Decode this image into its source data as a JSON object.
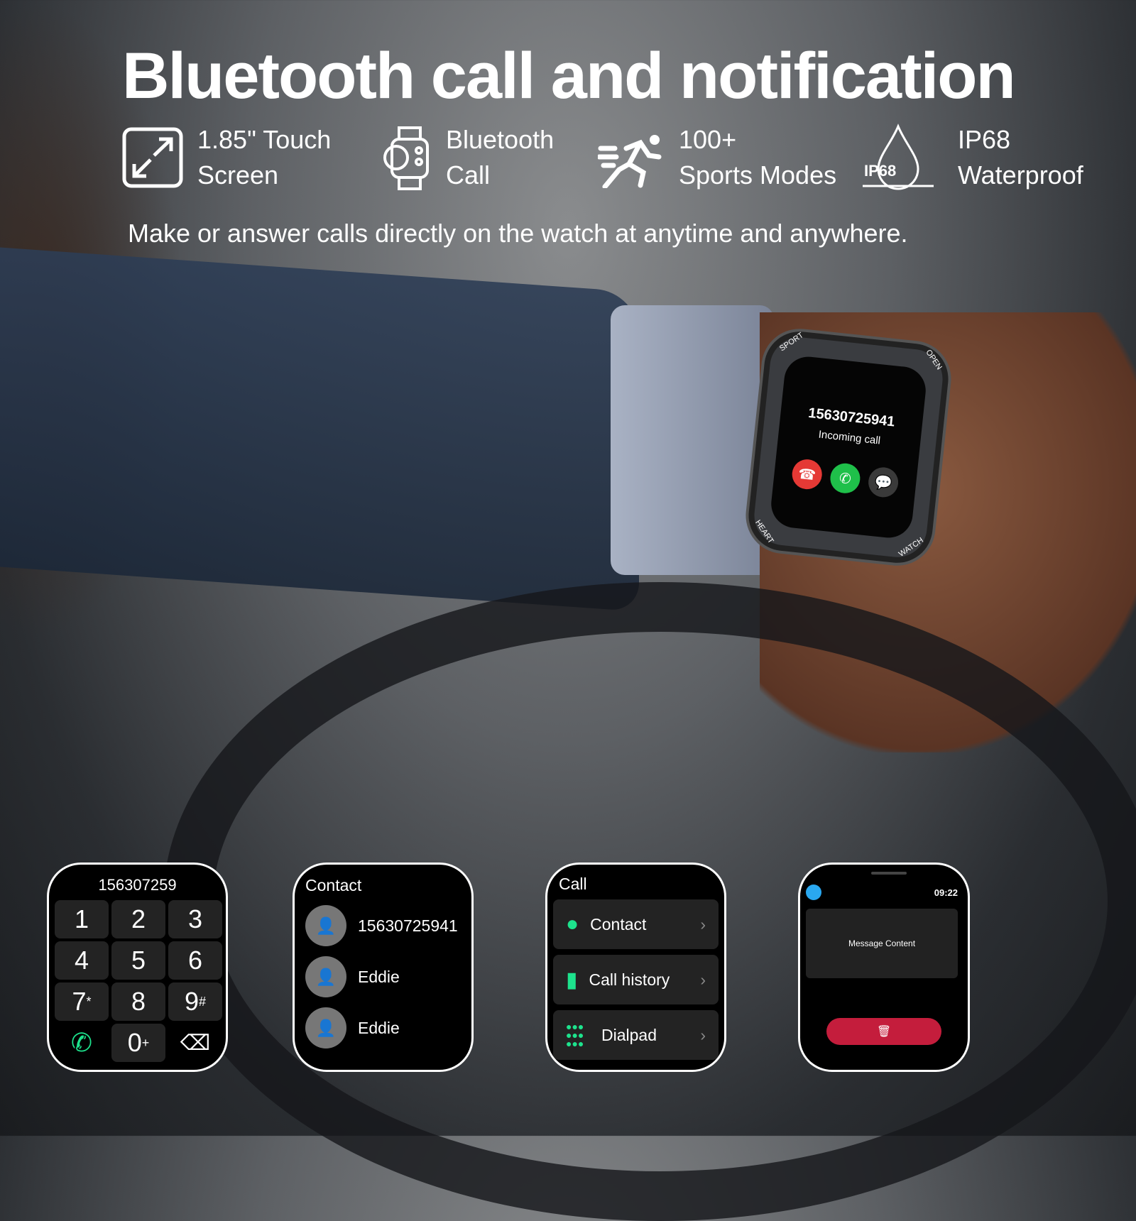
{
  "headline": "Bluetooth call and notification",
  "features": [
    {
      "icon": "expand-screen-icon",
      "line1": "1.85\" Touch",
      "line2": "Screen"
    },
    {
      "icon": "watch-call-icon",
      "line1": "Bluetooth",
      "line2": "Call"
    },
    {
      "icon": "running-icon",
      "line1": "100+",
      "line2": "Sports Modes"
    },
    {
      "icon": "water-drop-icon",
      "icon_label": "IP68",
      "line1": "IP68",
      "line2": "Waterproof"
    }
  ],
  "subtitle": "Make or answer calls directly on the watch at anytime and anywhere.",
  "watch": {
    "bezel": [
      "SPORT",
      "OPEN",
      "HEART",
      "WATCH"
    ],
    "number": "15630725941",
    "status": "Incoming call",
    "colors": {
      "decline": "#e53935",
      "accept": "#1fc04a",
      "message": "#3a3a3a"
    }
  },
  "dialpad": {
    "number": "156307259",
    "keys": [
      "1",
      "2",
      "3",
      "4",
      "5",
      "6",
      "7",
      "8",
      "9"
    ],
    "sup": {
      "7": "*",
      "9": "#"
    },
    "zero": "0",
    "zero_sup": "+"
  },
  "contacts": {
    "title": "Contact",
    "items": [
      "15630725941",
      "Eddie",
      "Eddie"
    ]
  },
  "call_menu": {
    "title": "Call",
    "items": [
      "Contact",
      "Call history",
      "Dialpad"
    ],
    "accent": "#1de38d"
  },
  "notification": {
    "time": "09:22",
    "message": "Message Content",
    "delete_color": "#c41d3c"
  }
}
